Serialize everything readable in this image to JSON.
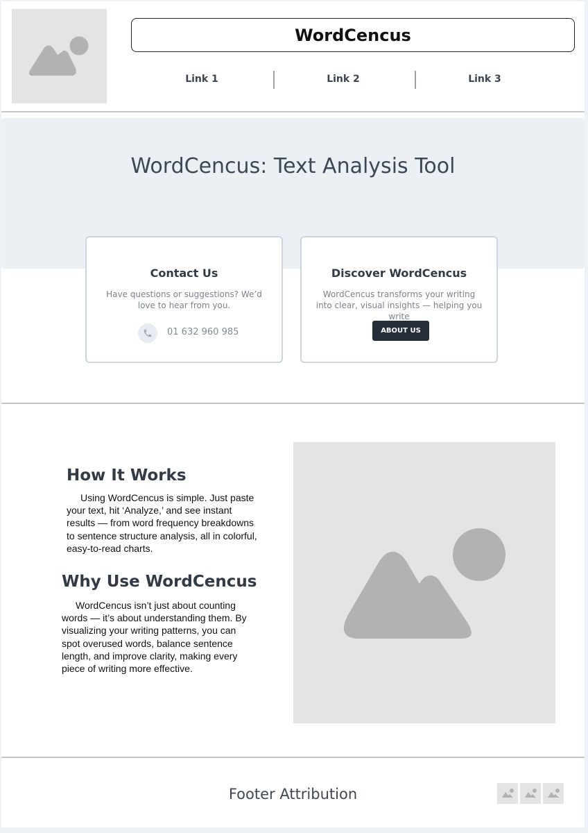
{
  "header": {
    "logo_icon": "image-placeholder-icon",
    "title": "WordCencus",
    "nav": [
      "Link 1",
      "Link 2",
      "Link 3"
    ]
  },
  "hero": {
    "title": "WordCencus: Text Analysis Tool"
  },
  "contact_card": {
    "title": "Contact Us",
    "text": "Have questions or suggestions? We’d love to hear from you.",
    "phone_icon": "phone-icon",
    "phone": "01 632 960 985"
  },
  "discover_card": {
    "title": "Discover WordCencus",
    "text": "WordCencus transforms your writing into clear, visual insights — helping you write",
    "button": "ABOUT US"
  },
  "how": {
    "title": "How It Works",
    "text": "Using WordCencus is simple. Just paste your text, hit ‘Analyze,’ and see instant results — from word frequency breakdowns to sentence structure analysis, all in colorful, easy-to-read charts."
  },
  "why": {
    "title": "Why Use WordCencus",
    "text": "WordCencus isn’t just about counting words — it’s about understanding them. By visualizing your writing patterns, you can spot overused words, balance sentence length, and improve clarity, making every piece of writing more effective."
  },
  "main_image": "image-placeholder-icon",
  "footer": {
    "text": "Footer Attribution",
    "social_icons": [
      "image-icon",
      "image-icon",
      "image-icon"
    ]
  },
  "colors": {
    "hero_bg": "#eceff4",
    "button_bg": "#252d38",
    "heading": "#323a46",
    "placeholder": "#e4e4e4"
  }
}
